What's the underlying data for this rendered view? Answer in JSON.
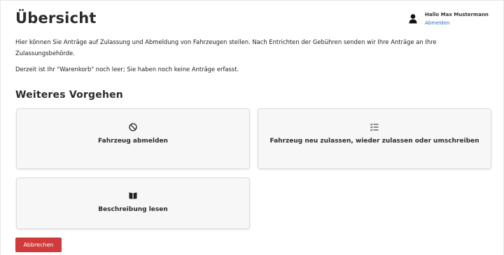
{
  "header": {
    "title": "Übersicht",
    "user": {
      "greeting": "Hallo Max Mustermann",
      "logout_label": "Abmelden",
      "icon": "user-icon"
    }
  },
  "intro": {
    "text": "Hier können Sie Anträge auf Zulassung und Abmeldung von Fahrzeugen stellen. Nach Entrichten der Gebühren senden wir Ihre Anträge an Ihre Zulassungsbehörde.",
    "status": "Derzeit ist Ihr \"Warenkorb\" noch leer; Sie haben noch keine Anträge erfasst."
  },
  "next_steps": {
    "heading": "Weiteres Vorgehen",
    "cards": [
      {
        "label": "Fahrzeug abmelden",
        "icon": "ban-icon"
      },
      {
        "label": "Fahrzeug neu zulassen, wieder zulassen oder umschreiben",
        "icon": "checklist-icon"
      },
      {
        "label": "Beschreibung lesen",
        "icon": "book-icon"
      }
    ]
  },
  "actions": {
    "cancel_label": "Abbrechen"
  },
  "colors": {
    "accent_link": "#2a6bc4",
    "cancel_button": "#d03a3a",
    "card_background": "#f7f7f7"
  }
}
